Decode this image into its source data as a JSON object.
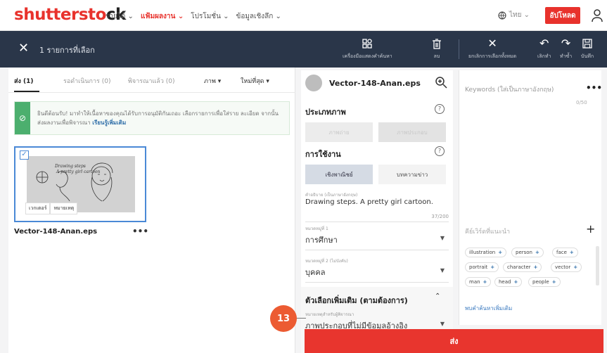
{
  "brand": {
    "logo_left": "shutterst",
    "logo_o": "o",
    "logo_right": "ck",
    "accent": "#e8322c"
  },
  "top_nav": {
    "links": [
      "รายได้ ⌄",
      "แฟ้มผลงาน ⌄",
      "โปรโมชั่น ⌄",
      "ข้อมูลเชิงลึก ⌄"
    ],
    "language": "ไทย ⌄",
    "upload_label": "อัปโหลด"
  },
  "toolbar": {
    "title": "1 รายการที่เลือก",
    "items": {
      "keyword_tool": "เครื่องมือแสดงคำค้นหา",
      "delete": "ลบ",
      "clear_selection": "ยกเลิกการเลือกทั้งหมด",
      "undo": "เลิกทำ",
      "redo": "ทำซ้ำ",
      "save": "บันทึก"
    }
  },
  "left_panel": {
    "tabs": [
      "ส่ง (1)",
      "รอดำเนินการ (0)",
      "พิจารณาแล้ว (0)"
    ],
    "filter": "ภาพ ▾",
    "sort": "ใหม่ที่สุด ▾",
    "info_text": "ยินดีต้อนรับ! มาทำให้เนื้อหาของคุณได้รับการอนุมัติกันเถอะ เลือกรายการเพื่อใส่ราย ละเอียด จากนั้นส่งผลงานเพื่อพิจารณา",
    "info_link": "เรียนรู้เพิ่มเติม",
    "card": {
      "tag_vector": "เวกเตอร์",
      "tag_note": "หมายเหตุ",
      "file_name": "Vector-148-Anan.eps",
      "more": "•••"
    }
  },
  "mid_panel": {
    "file_name": "Vector-148-Anan.eps",
    "image_type": {
      "title": "ประเภทภาพ",
      "opt1": "ภาพถ่าย",
      "opt2": "ภาพประกอบ"
    },
    "usage": {
      "title": "การใช้งาน",
      "opt1": "เชิงพาณิชย์",
      "opt2": "บทความข่าว"
    },
    "description": {
      "label": "คำอธิบาย (เป็นภาษาอังกฤษ)",
      "value": "Drawing steps. A pretty girl cartoon.",
      "counter": "37/200"
    },
    "category1": {
      "label": "หมวดหมู่ที่ 1",
      "value": "การศึกษา"
    },
    "category2": {
      "label": "หมวดหมู่ที่ 2 (ไม่บังคับ)",
      "value": "บุคคล"
    },
    "more_options": {
      "title": "ตัวเลือกเพิ่มเติม (ตามต้องการ)",
      "label": "หมายเหตุสำหรับผู้พิจารณา",
      "value": "ภาพประกอบที่ไม่มีข้อมูลอ้างอิง"
    }
  },
  "right_panel": {
    "keywords_title": "Keywords (ใส่เป็นภาษาอังกฤษ)",
    "keywords_count": "0/50",
    "more": "•••",
    "suggested_title": "คีย์เวิร์ดที่แนะนำ",
    "chips": [
      "illustration",
      "person",
      "face",
      "portrait",
      "character",
      "vector",
      "man",
      "head",
      "people"
    ],
    "find_link": "พบคำค้นหาเพิ่มเติม"
  },
  "submit_label": "ส่ง",
  "step_badge": "13"
}
